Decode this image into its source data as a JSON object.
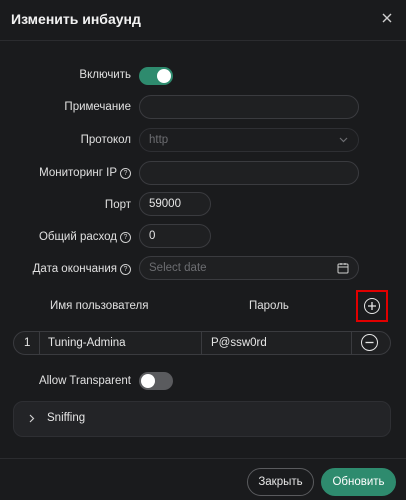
{
  "dialog": {
    "title": "Изменить инбаунд"
  },
  "colors": {
    "accent": "#2e8b6e",
    "toggle_off": "#5a5b5e",
    "highlight": "#e10000"
  },
  "form": {
    "enable": {
      "label": "Включить",
      "value": true
    },
    "remark": {
      "label": "Примечание",
      "value": ""
    },
    "protocol": {
      "label": "Протокол",
      "value": "http"
    },
    "monitor_ip": {
      "label": "Мониторинг IP",
      "value": ""
    },
    "port": {
      "label": "Порт",
      "value": "59000"
    },
    "total": {
      "label": "Общий расход",
      "value": "0"
    },
    "expiry": {
      "label": "Дата окончания",
      "placeholder": "Select date"
    }
  },
  "accounts": {
    "headers": {
      "user": "Имя пользователя",
      "password": "Пароль"
    },
    "rows": [
      {
        "index": "1",
        "user": "Tuning-Admina",
        "password": "P@ssw0rd"
      }
    ]
  },
  "allow_transparent": {
    "label": "Allow Transparent",
    "value": false
  },
  "sniffing": {
    "label": "Sniffing"
  },
  "footer": {
    "close": "Закрыть",
    "update": "Обновить"
  }
}
